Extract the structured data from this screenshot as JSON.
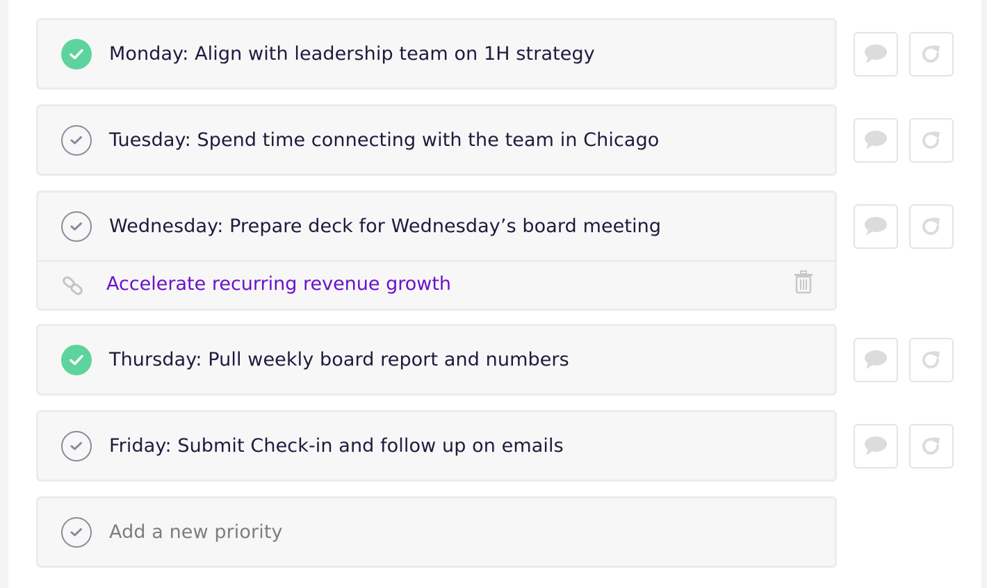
{
  "priorities": [
    {
      "text": "Monday: Align with leadership team on 1H strategy",
      "completed": true
    },
    {
      "text": "Tuesday: Spend time connecting with the team in Chicago",
      "completed": false
    },
    {
      "text": "Wednesday: Prepare deck for Wednesday’s board meeting",
      "completed": false,
      "linked_goal": {
        "label": "Accelerate recurring revenue growth",
        "icon": "link-icon",
        "remove_icon": "trash-icon"
      }
    },
    {
      "text": "Thursday: Pull weekly board report and numbers",
      "completed": true
    },
    {
      "text": "Friday: Submit Check-in and follow up on emails",
      "completed": false
    }
  ],
  "new_priority": {
    "placeholder": "Add a new priority"
  },
  "row_actions": {
    "comment_icon": "comment-icon",
    "repeat_icon": "repeat-icon"
  },
  "colors": {
    "completed_check": "#5dd39e",
    "open_check_border": "#888c9a",
    "linked_goal_text": "#6b12c9",
    "task_text": "#1f1a3d"
  }
}
